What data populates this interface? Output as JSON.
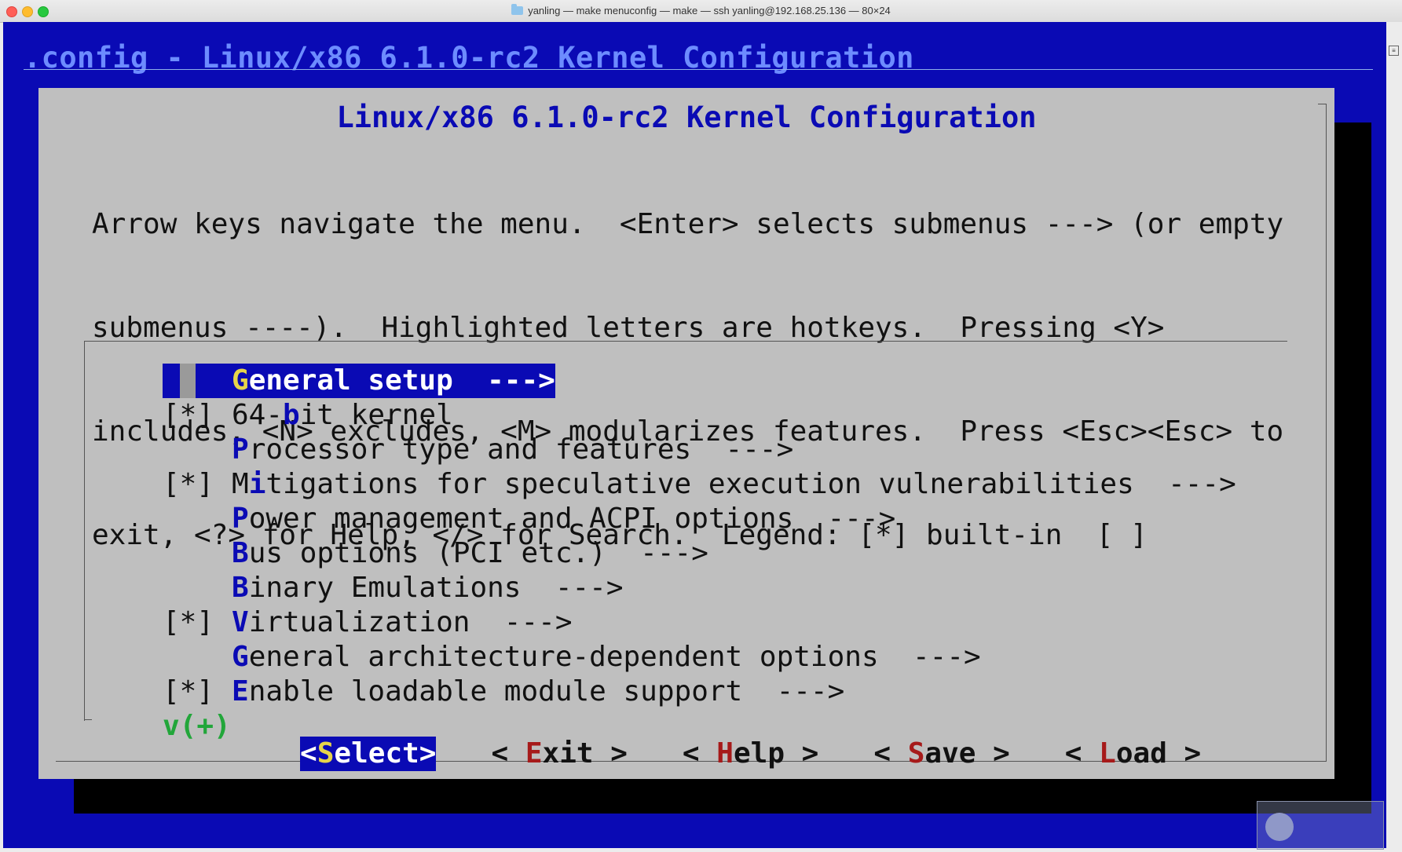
{
  "window": {
    "title": "yanling — make menuconfig — make — ssh yanling@192.168.25.136 — 80×24"
  },
  "header": {
    "text": ".config - Linux/x86 6.1.0-rc2 Kernel Configuration"
  },
  "dialog": {
    "title": "Linux/x86 6.1.0-rc2 Kernel Configuration",
    "help_lines": [
      "Arrow keys navigate the menu.  <Enter> selects submenus ---> (or empty",
      "submenus ----).  Highlighted letters are hotkeys.  Pressing <Y>",
      "includes, <N> excludes, <M> modularizes features.  Press <Esc><Esc> to",
      "exit, <?> for Help, </> for Search.  Legend: [*] built-in  [ ]"
    ]
  },
  "menu": {
    "items": [
      {
        "prefix": "",
        "hotkey": "G",
        "rest": "eneral setup  --->",
        "selected": true
      },
      {
        "prefix": "[*] ",
        "pre": "64-",
        "hotkey": "b",
        "rest": "it kernel",
        "selected": false
      },
      {
        "prefix": "",
        "hotkey": "P",
        "rest": "rocessor type and features  --->",
        "selected": false
      },
      {
        "prefix": "[*] ",
        "pre": "M",
        "hotkey": "i",
        "rest": "tigations for speculative execution vulnerabilities  --->",
        "selected": false
      },
      {
        "prefix": "",
        "hotkey": "P",
        "rest": "ower management and ACPI options  --->",
        "selected": false
      },
      {
        "prefix": "",
        "hotkey": "B",
        "rest": "us options (PCI etc.)  --->",
        "selected": false
      },
      {
        "prefix": "",
        "hotkey": "B",
        "rest": "inary Emulations  --->",
        "selected": false
      },
      {
        "prefix": "[*] ",
        "hotkey": "V",
        "rest": "irtualization  --->",
        "selected": false
      },
      {
        "prefix": "",
        "hotkey": "G",
        "rest": "eneral architecture-dependent options  --->",
        "selected": false
      },
      {
        "prefix": "[*] ",
        "hotkey": "E",
        "rest": "nable loadable module support  --->",
        "selected": false
      }
    ],
    "more_indicator": "v(+)"
  },
  "buttons": {
    "select": {
      "left": "<",
      "hotkey": "S",
      "rest": "elect",
      "right": ">"
    },
    "exit": {
      "left": "< ",
      "hotkey": "E",
      "rest": "xit",
      "right": " >"
    },
    "help": {
      "left": "< ",
      "hotkey": "H",
      "rest": "elp",
      "right": " >"
    },
    "save": {
      "left": "< ",
      "hotkey": "S",
      "rest": "ave",
      "right": " >"
    },
    "load": {
      "left": "< ",
      "hotkey": "L",
      "rest": "oad",
      "right": " >"
    }
  },
  "colors": {
    "terminal_bg": "#0a0ab4",
    "dialog_bg": "#bfbfbf",
    "hotkey": "#0a0ab4",
    "selected_hotkey": "#e6d44a",
    "button_hotkey": "#a61a1a",
    "more_indicator": "#22a63a"
  }
}
